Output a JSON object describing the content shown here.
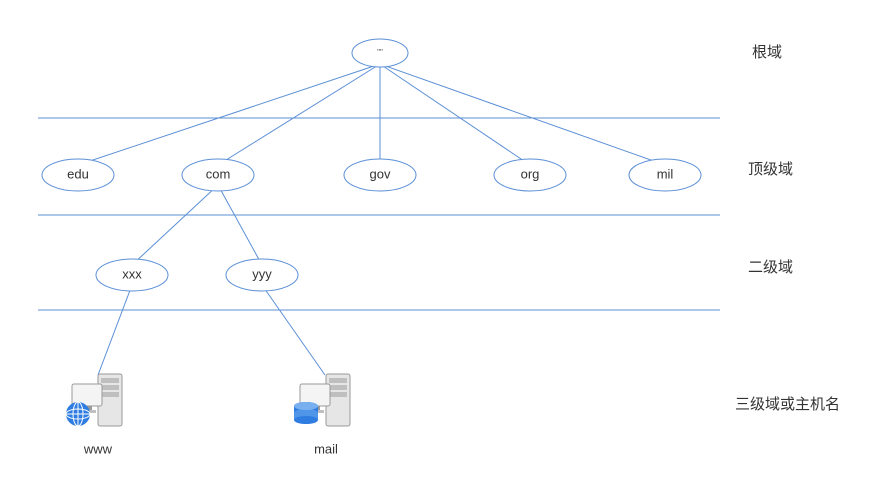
{
  "levels": {
    "root": {
      "label": "根域"
    },
    "tld": {
      "label": "顶级域"
    },
    "second": {
      "label": "二级域"
    },
    "third": {
      "label": "三级域或主机名"
    }
  },
  "nodes": {
    "root": {
      "label": "\"\""
    },
    "tld": [
      {
        "label": "edu"
      },
      {
        "label": "com"
      },
      {
        "label": "gov"
      },
      {
        "label": "org"
      },
      {
        "label": "mil"
      }
    ],
    "second": [
      {
        "label": "xxx"
      },
      {
        "label": "yyy"
      }
    ],
    "hosts": [
      {
        "label": "www",
        "icon": "web-server-icon"
      },
      {
        "label": "mail",
        "icon": "db-server-icon"
      }
    ]
  },
  "colors": {
    "line": "#5b8fd6",
    "server_body": "#e6e6e6",
    "server_dark": "#9a9a9a",
    "globe": "#2f7de1",
    "db": "#2f7de1"
  }
}
